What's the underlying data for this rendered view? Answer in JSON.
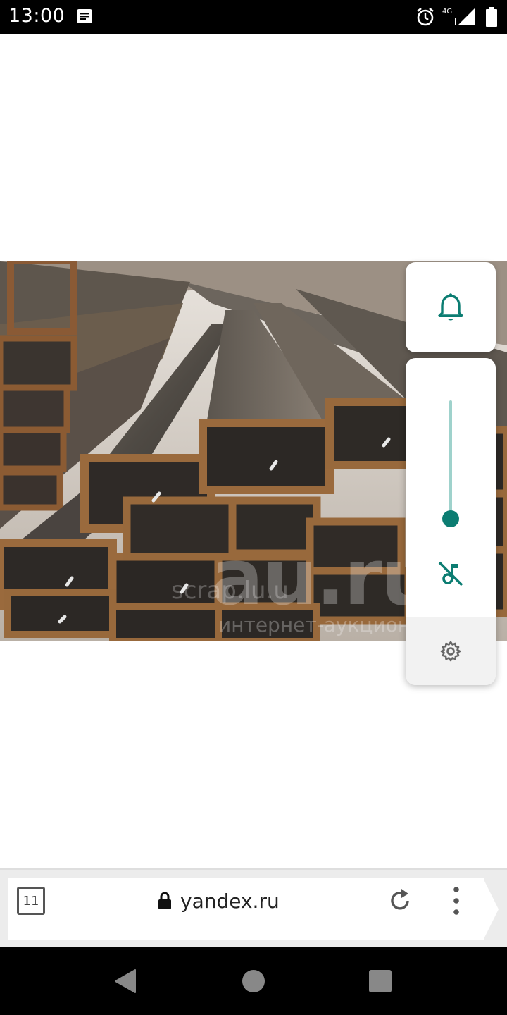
{
  "status_bar": {
    "time": "13:00",
    "network_type": "4G",
    "icons": [
      "notification-icon",
      "alarm-icon",
      "signal-icon",
      "battery-icon"
    ]
  },
  "photo": {
    "watermark_main": "au.ru",
    "watermark_site": "scrap.lu.u",
    "watermark_sub": "интернет-аукцион"
  },
  "volume_panel": {
    "ringer_icon": "bell-icon",
    "media_icon": "music-off-icon",
    "settings_icon": "gear-icon",
    "level": 0.0,
    "accent_color": "#0c7d72",
    "track_color": "#9fd2cc"
  },
  "browser": {
    "tab_count": "11",
    "url": "yandex.ru",
    "icons": [
      "lock-icon",
      "reload-icon",
      "overflow-menu-icon"
    ]
  },
  "nav_bar": {
    "icons": [
      "back-icon",
      "home-icon",
      "recents-icon"
    ]
  }
}
